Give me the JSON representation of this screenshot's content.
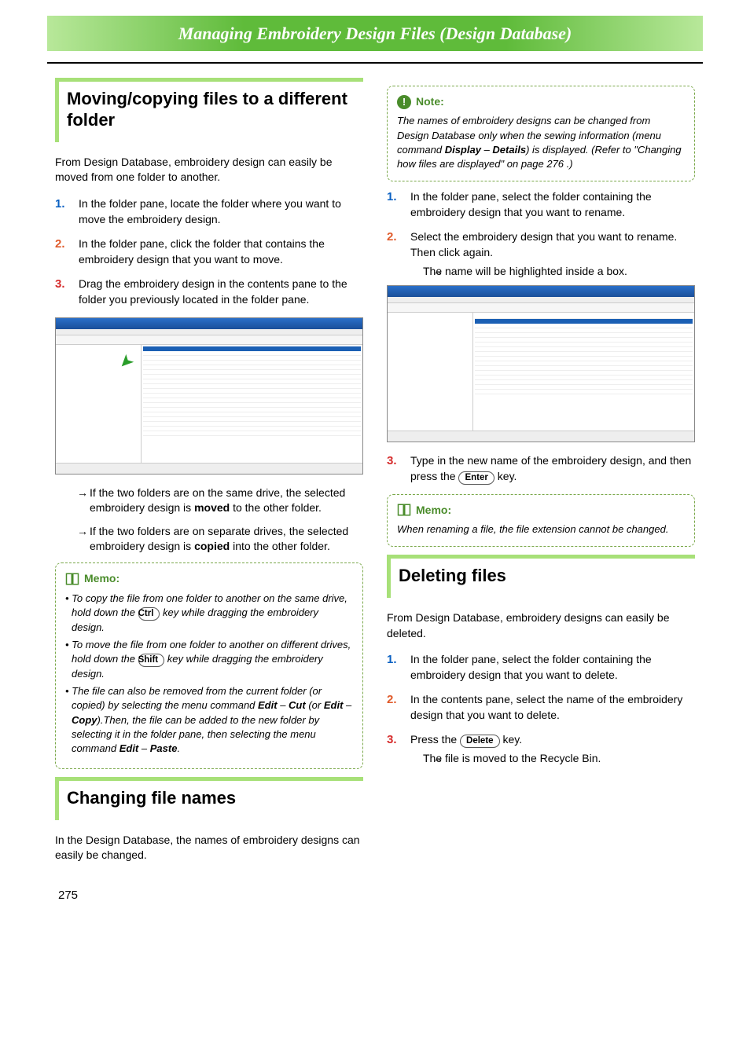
{
  "banner": "Managing Embroidery Design Files (Design Database)",
  "page_number": "275",
  "left": {
    "h_moving": "Moving/copying files to a different folder",
    "intro_moving": "From Design Database, embroidery design can easily be moved from one folder to another.",
    "steps_moving": {
      "s1": "In the folder pane, locate the folder where you want to move the embroidery design.",
      "s2": "In the folder pane, click the folder that contains the embroidery design that you want to move.",
      "s3": "Drag the embroidery design in the contents pane to the folder you previously located in the folder pane."
    },
    "arrow1_a": "If the two folders are on the same drive, the selected embroidery design is ",
    "arrow1_b": "moved",
    "arrow1_c": " to the other folder.",
    "arrow2_a": "If the two folders are on separate drives, the selected embroidery design is ",
    "arrow2_b": "copied",
    "arrow2_c": " into the other folder.",
    "memo_label": "Memo:",
    "memo_li1_a": "To copy the file from one folder to another on the same drive, hold down the ",
    "memo_li1_key": "Ctrl",
    "memo_li1_b": " key while dragging the embroidery design.",
    "memo_li2_a": "To move the file from one folder to another on different drives, hold down the ",
    "memo_li2_key": "Shift",
    "memo_li2_b": " key while dragging the embroidery design.",
    "memo_li3_a": "The file can also be removed from the current folder (or copied) by selecting the menu command ",
    "memo_li3_cmd1": "Edit",
    "memo_li3_dash": " – ",
    "memo_li3_cmd2": "Cut",
    "memo_li3_mid": " (or ",
    "memo_li3_cmd3": "Edit",
    "memo_li3_dash2": " – ",
    "memo_li3_cmd4": "Copy",
    "memo_li3_b": ").Then, the file can be added to the new folder by selecting it in the folder pane, then selecting the menu command ",
    "memo_li3_cmd5": "Edit",
    "memo_li3_dash3": " – ",
    "memo_li3_cmd6": "Paste",
    "memo_li3_end": ".",
    "h_changing": "Changing file names",
    "intro_changing": "In the Design Database, the names of embroidery designs can easily be changed."
  },
  "right": {
    "note_label": "Note:",
    "note_a": "The names of embroidery designs can be changed from Design Database only when the sewing information (menu command ",
    "note_cmd1": "Display",
    "note_dash": " – ",
    "note_cmd2": "Details",
    "note_b": ") is displayed. (Refer to \"Changing how files are displayed\" on page 276 .)",
    "steps_changing": {
      "s1": "In the folder pane, select the folder containing the embroidery design that you want to rename.",
      "s2": "Select the embroidery design that you want to rename. Then click again.",
      "s2_arrow": "The name will be highlighted inside a box.",
      "s3_a": "Type in the new name of the embroidery design, and then press the ",
      "s3_key": "Enter",
      "s3_b": " key."
    },
    "memo2_label": "Memo:",
    "memo2_text": "When renaming a file, the file extension cannot be changed.",
    "h_deleting": "Deleting files",
    "intro_deleting": "From Design Database, embroidery designs can easily be deleted.",
    "steps_deleting": {
      "s1": "In the folder pane, select the folder containing the embroidery design that you want to delete.",
      "s2": "In the contents pane, select the name of the embroidery design that you want to delete.",
      "s3_a": "Press the ",
      "s3_key": "Delete",
      "s3_b": " key.",
      "s3_arrow": "The file is moved to the Recycle Bin."
    }
  }
}
